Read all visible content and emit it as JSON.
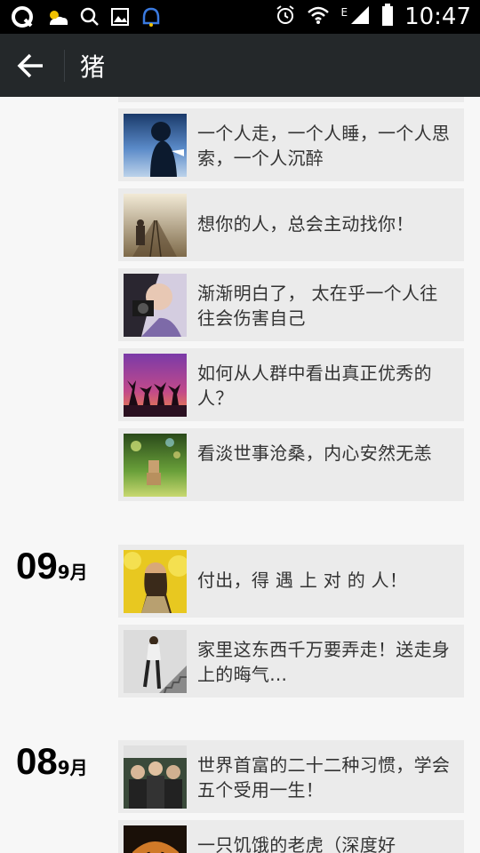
{
  "statusbar": {
    "time": "10:47",
    "network": "E",
    "icons": [
      "app-q-icon",
      "weather-icon",
      "search-icon",
      "gallery-icon",
      "messenger-icon",
      "alarm-icon",
      "wifi-icon",
      "signal-icon",
      "battery-icon"
    ]
  },
  "navbar": {
    "title": "猪",
    "back_icon": "arrow-left-icon"
  },
  "groups": [
    {
      "items": [
        {
          "text": "一个人走，一个人睡，一个人思索，一个人沉醉",
          "thumb": "silhouette-blue"
        },
        {
          "text": "想你的人，总会主动找你！",
          "thumb": "railway-sepia"
        },
        {
          "text": "渐渐明白了， 太在乎一个人往往会伤害自己",
          "thumb": "girl-camera"
        },
        {
          "text": "如何从人群中看出真正优秀的人？",
          "thumb": "jumping-sunset"
        },
        {
          "text": "看淡世事沧桑，内心安然无恙",
          "thumb": "robot-grass"
        }
      ]
    },
    {
      "day": "09",
      "month": "9月",
      "items": [
        {
          "text": "付出，得 遇 上 对 的 人！",
          "thumb": "man-yellow-tree"
        },
        {
          "text": "家里这东西千万要弄走！送走身上的晦气...",
          "thumb": "woman-stairs"
        }
      ]
    },
    {
      "day": "08",
      "month": "9月",
      "items": [
        {
          "text": "世界首富的二十二种习惯，学会五个受用一生！",
          "thumb": "rich-men-cover"
        },
        {
          "text": "一只饥饿的老虎（深度好",
          "thumb": "tiger"
        }
      ]
    }
  ]
}
